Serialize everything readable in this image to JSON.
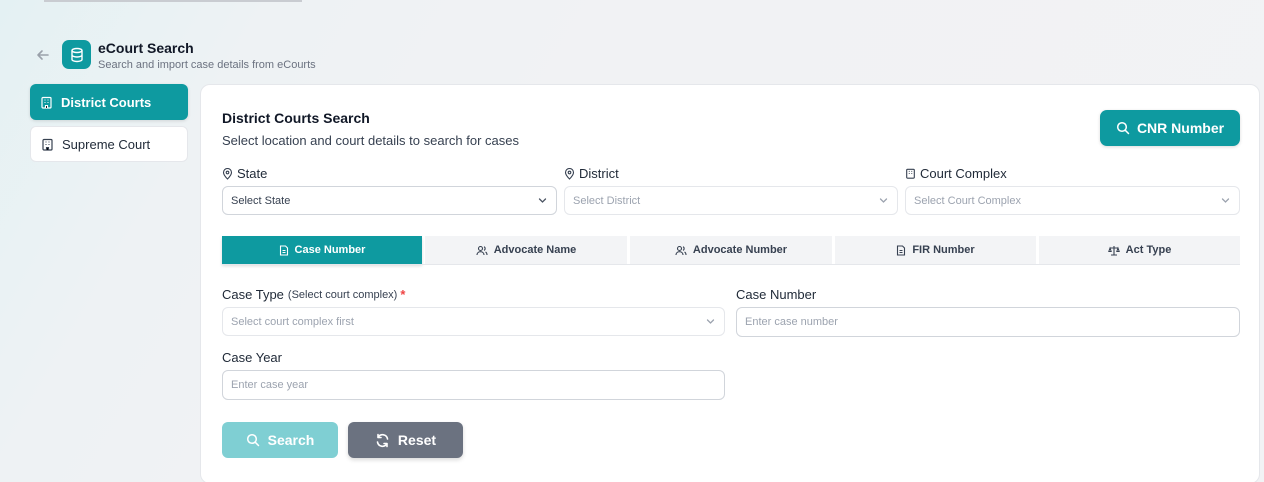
{
  "header": {
    "title": "eCourt Search",
    "subtitle": "Search and import case details from eCourts"
  },
  "sidebar": {
    "items": [
      {
        "label": "District Courts",
        "icon": "building-icon",
        "active": true
      },
      {
        "label": "Supreme Court",
        "icon": "building-icon",
        "active": false
      }
    ]
  },
  "main": {
    "title": "District Courts Search",
    "subtitle": "Select location and court details to search for cases",
    "cnr_button": "CNR Number",
    "state": {
      "label": "State",
      "value": "Select State"
    },
    "district": {
      "label": "District",
      "value": "Select District"
    },
    "court_complex": {
      "label": "Court Complex",
      "value": "Select Court Complex"
    },
    "tabs": [
      {
        "label": "Case Number",
        "icon": "document-icon",
        "active": true
      },
      {
        "label": "Advocate Name",
        "icon": "users-icon",
        "active": false
      },
      {
        "label": "Advocate Number",
        "icon": "users-icon",
        "active": false
      },
      {
        "label": "FIR Number",
        "icon": "document-icon",
        "active": false
      },
      {
        "label": "Act Type",
        "icon": "scale-icon",
        "active": false
      }
    ],
    "case_type": {
      "label": "Case Type",
      "hint": "(Select court complex)",
      "required_mark": "*",
      "placeholder": "Select court complex first"
    },
    "case_number": {
      "label": "Case Number",
      "placeholder": "Enter case number"
    },
    "case_year": {
      "label": "Case Year",
      "placeholder": "Enter case year"
    },
    "search_button": "Search",
    "reset_button": "Reset"
  },
  "colors": {
    "accent": "#0e9aa0",
    "accent_light": "#7fcfd3",
    "reset": "#6b7280",
    "required": "#ef4444"
  }
}
